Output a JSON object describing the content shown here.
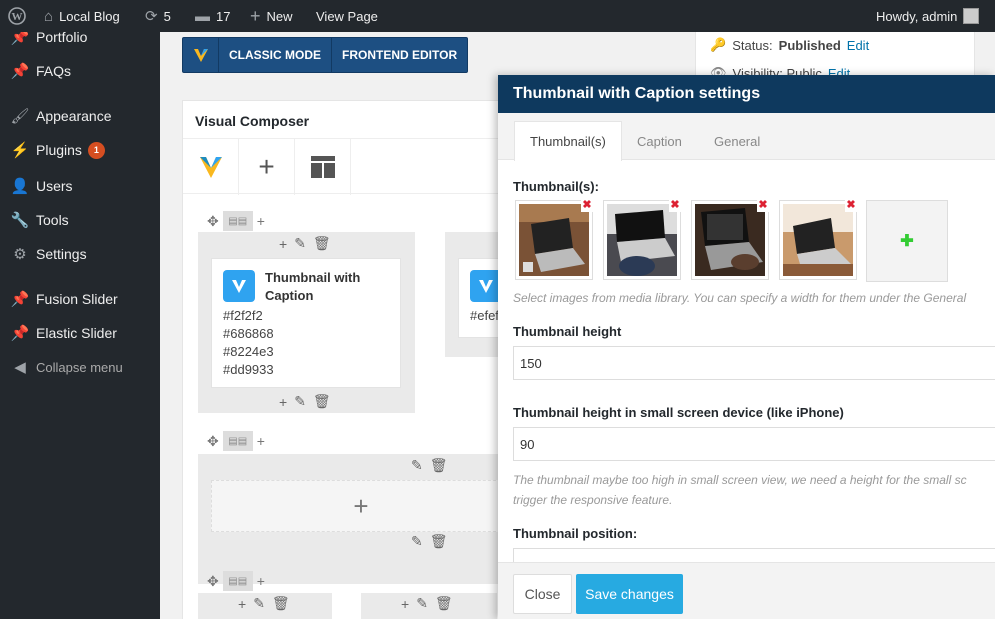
{
  "admin_bar": {
    "site_name": "Local Blog",
    "updates_count": "5",
    "comments_count": "17",
    "new_label": "New",
    "view_page_label": "View Page",
    "howdy": "Howdy, admin"
  },
  "sidebar": {
    "items": [
      {
        "label": "Portfolio",
        "icon": "pin-icon"
      },
      {
        "label": "FAQs",
        "icon": "pin-icon"
      },
      {
        "label": "Appearance",
        "icon": "brush-icon"
      },
      {
        "label": "Plugins",
        "icon": "plug-icon",
        "badge": "1"
      },
      {
        "label": "Users",
        "icon": "user-icon"
      },
      {
        "label": "Tools",
        "icon": "wrench-icon"
      },
      {
        "label": "Settings",
        "icon": "settings-icon"
      },
      {
        "label": "Fusion Slider",
        "icon": "pin-icon"
      },
      {
        "label": "Elastic Slider",
        "icon": "pin-icon"
      }
    ],
    "collapse_label": "Collapse menu"
  },
  "editor_mode": {
    "classic_label": "CLASSIC MODE",
    "frontend_label": "FRONTEND EDITOR"
  },
  "publish": {
    "status_label": "Status:",
    "status_value": "Published",
    "edit_label": "Edit",
    "visibility_label": "Visibility: Public",
    "visibility_edit": "Edit"
  },
  "composer": {
    "title": "Visual Composer",
    "element_title": "Thumbnail with Caption",
    "colors": [
      "#f2f2f2",
      "#686868",
      "#8224e3",
      "#dd9933"
    ],
    "partial_color": "#efef"
  },
  "modal": {
    "title": "Thumbnail with Caption settings",
    "tabs": [
      "Thumbnail(s)",
      "Caption",
      "General"
    ],
    "thumbnails_label": "Thumbnail(s):",
    "thumbnails_hint": "Select images from media library. You can specify a width for them under the General",
    "height_label": "Thumbnail height",
    "height_value": "150",
    "small_height_label": "Thumbnail height in small screen device (like iPhone)",
    "small_height_value": "90",
    "small_hint_1": "The thumbnail maybe too high in small screen view, we need a height for the small sc",
    "small_hint_2": "trigger the responsive feature.",
    "position_label": "Thumbnail position:",
    "close_label": "Close",
    "save_label": "Save changes"
  }
}
